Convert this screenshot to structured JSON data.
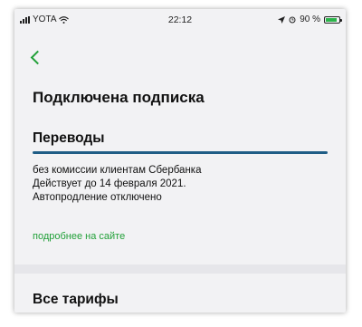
{
  "status_bar": {
    "carrier": "YOTA",
    "time": "22:12",
    "battery": "90 %",
    "battery_level": 0.9,
    "colors": {
      "battery_fill": "#2bb44a"
    }
  },
  "header": {
    "title": "Подключена подписка"
  },
  "subscription": {
    "name": "Переводы",
    "progress": 1.0,
    "lines": [
      "без комиссии клиентам Сбербанка",
      "Действует до 14 февраля 2021.",
      "Автопродление отключено"
    ],
    "link_label": "подробнее на сайте"
  },
  "section": {
    "title": "Все тарифы"
  },
  "colors": {
    "accent": "#21a038",
    "progress": "#1f5d86",
    "background": "#f2f2f4"
  }
}
